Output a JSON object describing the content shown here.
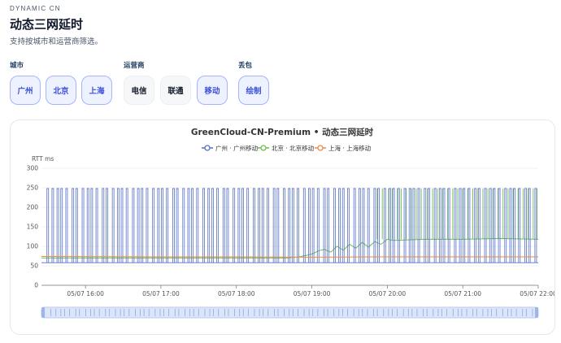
{
  "header": {
    "eyebrow": "DYNAMIC CN",
    "title": "动态三网延时",
    "subtitle": "支持按城市和运营商筛选。"
  },
  "filters": {
    "city": {
      "label": "城市",
      "options": [
        {
          "label": "广州",
          "active": true
        },
        {
          "label": "北京",
          "active": true
        },
        {
          "label": "上海",
          "active": true
        }
      ]
    },
    "isp": {
      "label": "运营商",
      "options": [
        {
          "label": "电信",
          "active": false
        },
        {
          "label": "联通",
          "active": false
        },
        {
          "label": "移动",
          "active": true
        }
      ]
    },
    "loss": {
      "label": "丢包",
      "options": [
        {
          "label": "绘制",
          "active": true
        }
      ]
    }
  },
  "colors": {
    "accent": "#3b4fd8",
    "guangzhou": "#5470c6",
    "beijing": "#6cc04a",
    "shanghai": "#f08a3c"
  },
  "chart_data": {
    "type": "line",
    "title": "GreenCloud-CN-Premium • 动态三网延时",
    "ylabel": "RTT ms",
    "ylim": [
      0,
      300
    ],
    "yticks": [
      0,
      50,
      100,
      150,
      200,
      250,
      300
    ],
    "xlim": [
      "05/07 15:25",
      "05/07 22:00"
    ],
    "xticks": [
      "05/07 16:00",
      "05/07 17:00",
      "05/07 18:00",
      "05/07 19:00",
      "05/07 20:00",
      "05/07 21:00",
      "05/07 22:00"
    ],
    "grid": true,
    "legend_position": "top",
    "loss_cap_ms": 248,
    "series": [
      {
        "name": "广州 · 广州移动",
        "color": "#5470c6",
        "baseline_ms": 58,
        "spike_times": [
          "15:30",
          "15:34",
          "15:38",
          "15:41",
          "15:45",
          "15:50",
          "15:53",
          "15:58",
          "16:02",
          "16:05",
          "16:09",
          "16:14",
          "16:17",
          "16:22",
          "16:26",
          "16:29",
          "16:33",
          "16:38",
          "16:42",
          "16:45",
          "16:49",
          "16:54",
          "16:58",
          "17:01",
          "17:05",
          "17:10",
          "17:13",
          "17:18",
          "17:22",
          "17:25",
          "17:29",
          "17:34",
          "17:38",
          "17:41",
          "17:45",
          "17:50",
          "17:53",
          "17:58",
          "18:02",
          "18:05",
          "18:09",
          "18:14",
          "18:18",
          "18:21",
          "18:25",
          "18:30",
          "18:33",
          "18:38",
          "18:42",
          "18:45",
          "18:49",
          "18:54",
          "18:58",
          "19:01",
          "19:05",
          "19:10",
          "19:13",
          "19:18",
          "19:22",
          "19:25",
          "19:29",
          "19:34",
          "19:38",
          "19:41",
          "19:45",
          "19:50",
          "19:53",
          "19:58",
          "20:02",
          "20:05",
          "20:09",
          "20:14",
          "20:18",
          "20:21",
          "20:25",
          "20:30",
          "20:33",
          "20:38",
          "20:42",
          "20:45",
          "20:49",
          "20:54",
          "20:58",
          "21:01",
          "21:05",
          "21:10",
          "21:13",
          "21:18",
          "21:22",
          "21:25",
          "21:29",
          "21:34",
          "21:38",
          "21:41",
          "21:45",
          "21:50",
          "21:53",
          "21:58"
        ]
      },
      {
        "name": "北京 · 北京移动",
        "color": "#6cc04a",
        "points": [
          [
            "15:25",
            70
          ],
          [
            "18:40",
            70
          ],
          [
            "18:50",
            73
          ],
          [
            "19:00",
            80
          ],
          [
            "19:05",
            88
          ],
          [
            "19:10",
            92
          ],
          [
            "19:15",
            85
          ],
          [
            "19:20",
            100
          ],
          [
            "19:25",
            90
          ],
          [
            "19:30",
            105
          ],
          [
            "19:35",
            95
          ],
          [
            "19:40",
            110
          ],
          [
            "19:45",
            98
          ],
          [
            "19:50",
            112
          ],
          [
            "19:55",
            105
          ],
          [
            "20:00",
            118
          ],
          [
            "20:05",
            115
          ],
          [
            "20:30",
            118
          ],
          [
            "21:00",
            118
          ],
          [
            "21:30",
            120
          ],
          [
            "22:00",
            118
          ]
        ],
        "spike_times": [
          "19:52",
          "19:56",
          "20:01",
          "20:04",
          "20:08",
          "20:11",
          "20:15",
          "20:19",
          "20:23",
          "20:27",
          "20:32",
          "20:36",
          "20:40",
          "20:44",
          "20:48",
          "20:52",
          "20:56",
          "21:00",
          "21:04",
          "21:08",
          "21:12",
          "21:16",
          "21:20",
          "21:24",
          "21:28",
          "21:32",
          "21:36",
          "21:40",
          "21:44",
          "21:48",
          "21:52",
          "21:56",
          "21:59"
        ]
      },
      {
        "name": "上海 · 上海移动",
        "color": "#f08a3c",
        "points": [
          [
            "15:25",
            74
          ],
          [
            "17:00",
            73
          ],
          [
            "18:00",
            73
          ],
          [
            "19:00",
            72
          ],
          [
            "20:00",
            73
          ],
          [
            "21:00",
            73
          ],
          [
            "22:00",
            73
          ]
        ]
      }
    ]
  }
}
